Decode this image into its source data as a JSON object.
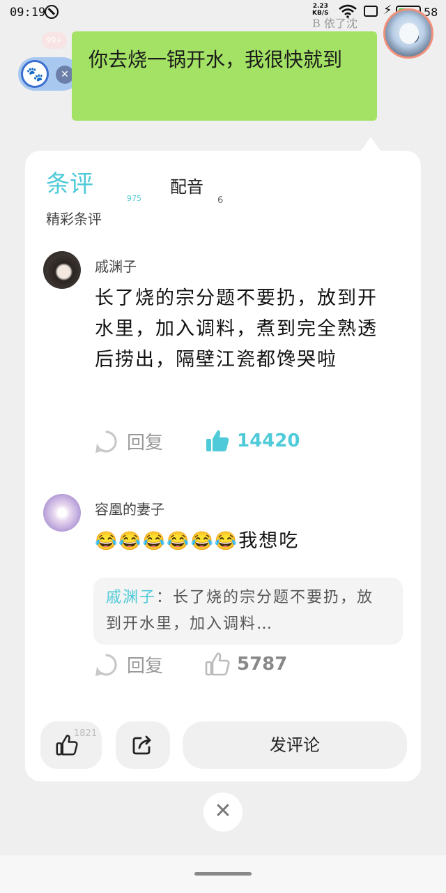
{
  "status_bar": {
    "time": "09:19",
    "net_speed_value": "2.23",
    "net_speed_unit": "KB/S",
    "battery_level": "58",
    "battery_fraction": 0.58,
    "author_tag": "B 依了沈"
  },
  "floating": {
    "badge": "99+",
    "close_glyph": "✕"
  },
  "speech_bubble": {
    "text": "你去烧一锅开水，我很快就到"
  },
  "tabs": {
    "comments_label": "条评",
    "comments_count": "975",
    "dubbing_label": "配音",
    "dubbing_count": "6"
  },
  "section_title": "精彩条评",
  "comments": [
    {
      "author": "戚渊子",
      "text": "长了烧的宗分题不要扔，放到开水里，加入调料，煮到完全熟透后捞出，隔壁江瓷都馋哭啦",
      "reply_label": "回复",
      "likes": "14420",
      "liked": true
    },
    {
      "author": "容凰的妻子",
      "emojis": "😂😂😂😂😂😂",
      "text": "我想吃",
      "quote_author": "戚渊子",
      "quote_text": "：长了烧的宗分题不要扔，放到开水里，加入调料…",
      "reply_label": "回复",
      "likes": "5787",
      "liked": false
    }
  ],
  "bottom_bar": {
    "like_count": "1821",
    "post_label": "发评论"
  },
  "close_glyph": "✕",
  "colors": {
    "accent": "#4fcad8",
    "bubble": "#a3e264",
    "muted": "#999999"
  }
}
